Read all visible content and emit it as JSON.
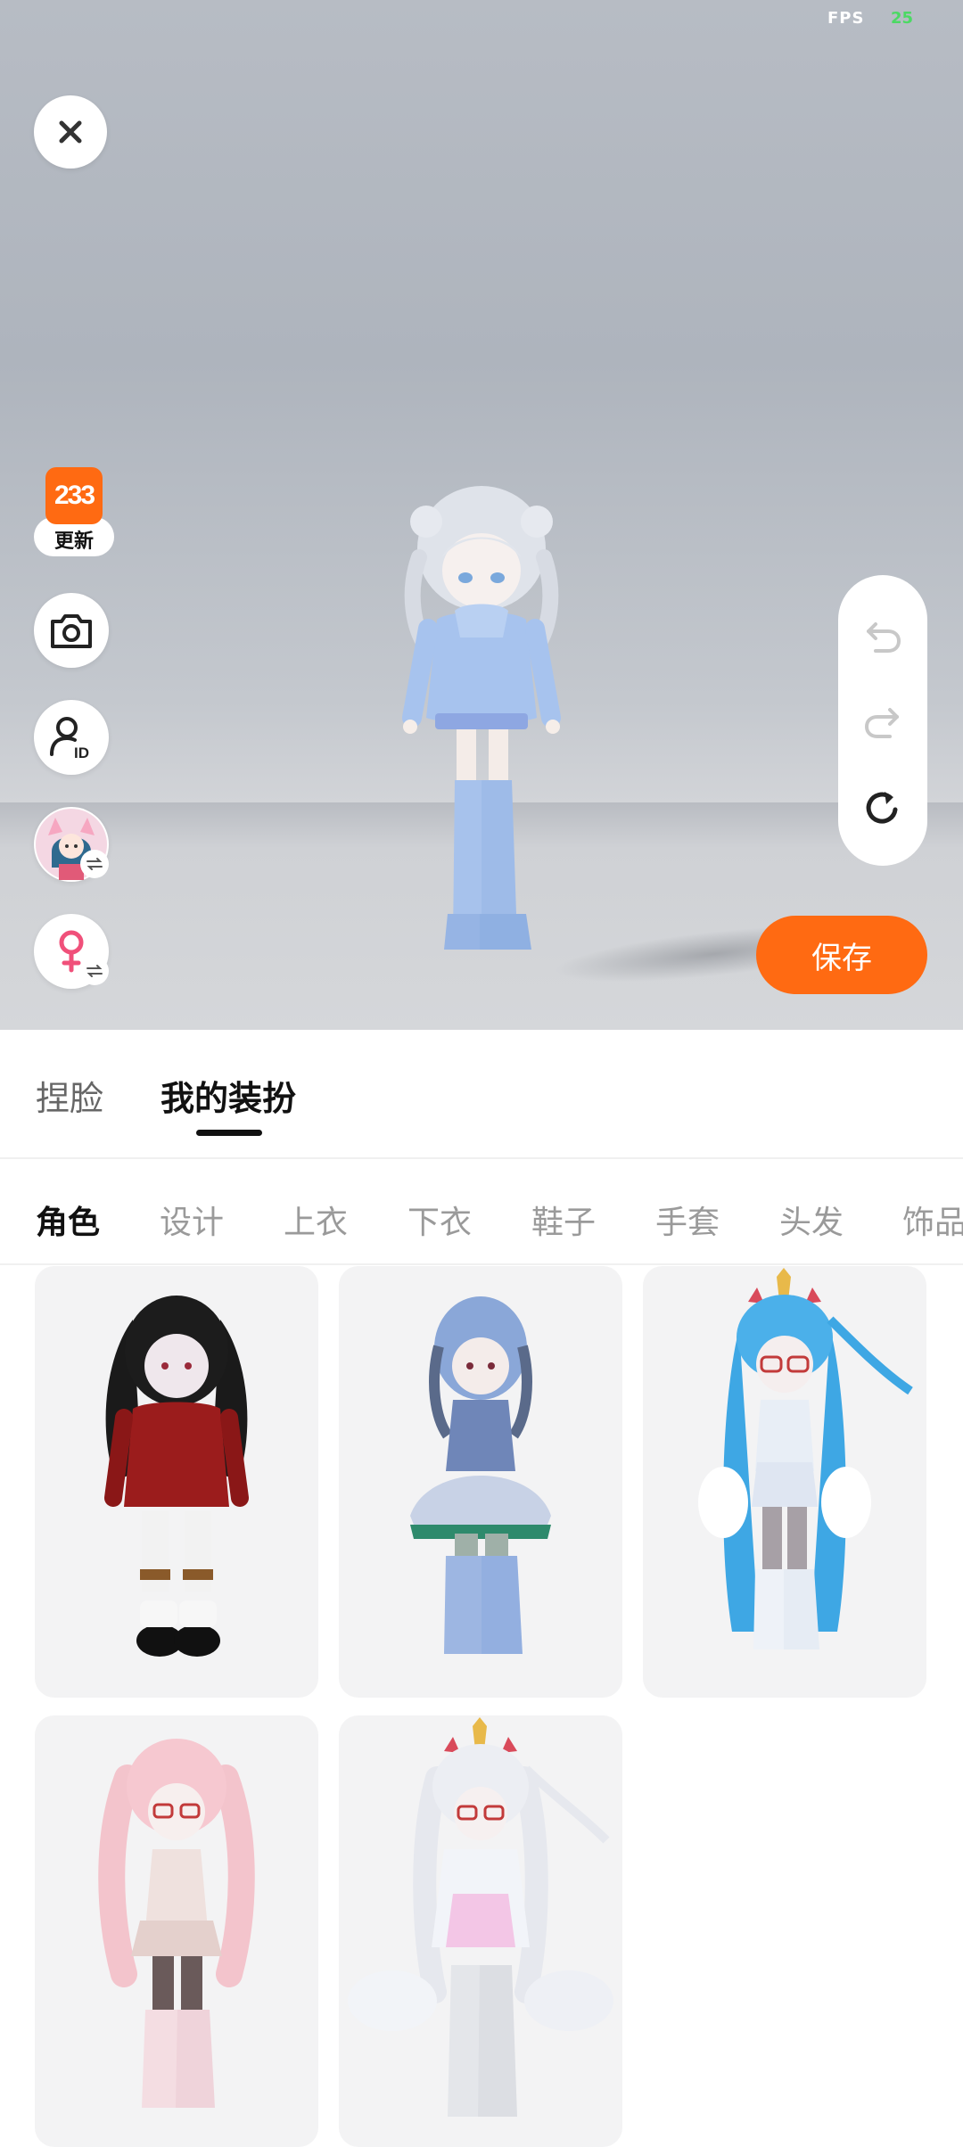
{
  "status": {
    "fps_label": "FPS",
    "fps_value": "25"
  },
  "viewport": {
    "close_icon": "close-icon",
    "update_badge": {
      "logo_text": "233",
      "label": "更新"
    },
    "camera_icon": "camera-icon",
    "id_icon": "profile-id-icon",
    "avatar_swap_icon": "swap-icon",
    "gender_icon": "female-icon",
    "undo_icon": "undo-icon",
    "redo_icon": "redo-icon",
    "reset_icon": "reset-icon",
    "save_label": "保存"
  },
  "tabs": [
    {
      "label": "捏脸",
      "active": false
    },
    {
      "label": "我的装扮",
      "active": true
    }
  ],
  "categories": [
    {
      "label": "角色",
      "active": true
    },
    {
      "label": "设计",
      "active": false
    },
    {
      "label": "上衣",
      "active": false
    },
    {
      "label": "下衣",
      "active": false
    },
    {
      "label": "鞋子",
      "active": false
    },
    {
      "label": "手套",
      "active": false
    },
    {
      "label": "头发",
      "active": false
    },
    {
      "label": "饰品",
      "active": false
    }
  ],
  "outfits": [
    {
      "name": "outfit-red-hoodie-black-hair"
    },
    {
      "name": "outfit-blue-dress"
    },
    {
      "name": "outfit-unicorn-blue-hair"
    },
    {
      "name": "outfit-pink-hair"
    },
    {
      "name": "outfit-unicorn-white"
    }
  ],
  "colors": {
    "accent": "#ff6a12",
    "fps_green": "#4cd964",
    "text_primary": "#111111",
    "text_secondary": "#9a9a9a"
  }
}
